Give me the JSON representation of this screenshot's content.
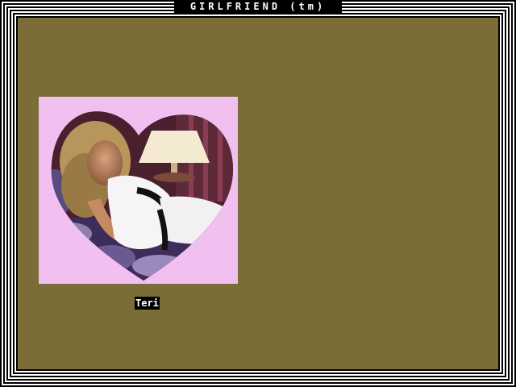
{
  "window": {
    "title": "GIRLFRIEND (tm)"
  },
  "colors": {
    "panel_background": "#7b6d38",
    "photo_background": "#f1bff0",
    "label_background": "#000000",
    "label_text": "#ffffff"
  },
  "girlfriend": {
    "name": "Teri",
    "photo_icon": "heart-photo-icon"
  }
}
